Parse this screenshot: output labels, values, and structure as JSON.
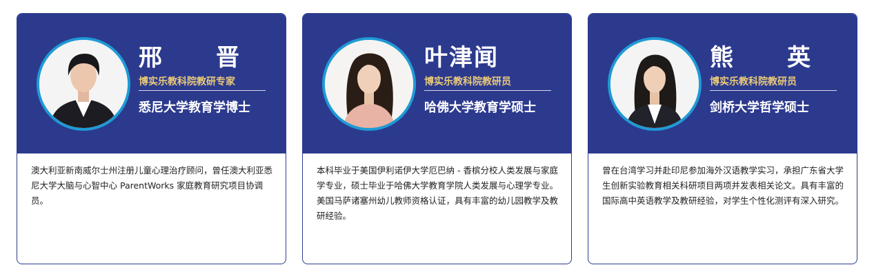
{
  "colors": {
    "header_bg": "#2c3a8e",
    "role_text": "#e9c97a",
    "avatar_ring": "#1f9ad6"
  },
  "cards": [
    {
      "name": "邢　晋",
      "role": "博实乐教科院教研专家",
      "degree": "悉尼大学教育学博士",
      "bio": "澳大利亚新南威尔士州注册儿童心理治疗顾问，曾任澳大利亚悉尼大学大脑与心智中心 ParentWorks 家庭教育研究项目协调员。",
      "avatar_icon": "person-photo-icon"
    },
    {
      "name": "叶津闻",
      "role": "博实乐教科院教研员",
      "degree": "哈佛大学教育学硕士",
      "bio": "本科毕业于美国伊利诺伊大学厄巴纳 - 香槟分校人类发展与家庭学专业，硕士毕业于哈佛大学教育学院人类发展与心理学专业。美国马萨诸塞州幼儿教师资格认证，具有丰富的幼儿园教学及教研经验。",
      "avatar_icon": "person-photo-icon"
    },
    {
      "name": "熊　英",
      "role": "博实乐教科院教研员",
      "degree": "剑桥大学哲学硕士",
      "bio": "曾在台湾学习并赴印尼参加海外汉语教学实习，承担广东省大学生创新实验教育相关科研项目两项并发表相关论文。具有丰富的国际高中英语教学及教研经验，对学生个性化测评有深入研究。",
      "avatar_icon": "person-photo-icon"
    }
  ]
}
